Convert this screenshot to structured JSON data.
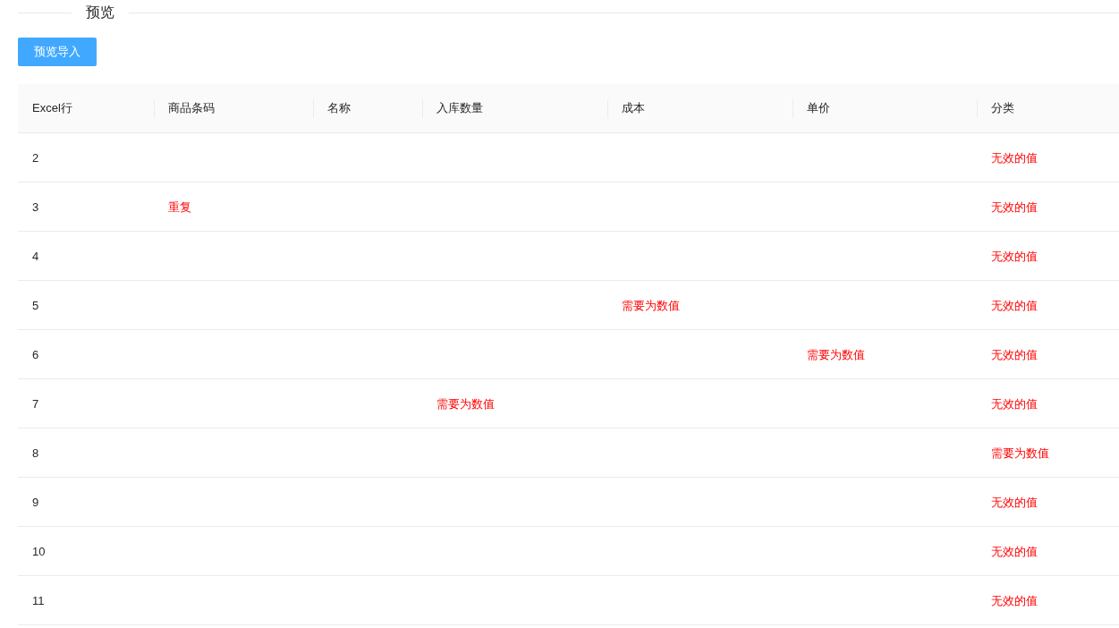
{
  "section": {
    "title": "预览"
  },
  "import_button": {
    "label": "预览导入"
  },
  "table": {
    "columns": [
      "Excel行",
      "商品条码",
      "名称",
      "入库数量",
      "成本",
      "单价",
      "分类"
    ],
    "rows": [
      {
        "excel_row": "2",
        "category": "无效的值"
      },
      {
        "excel_row": "3",
        "barcode": "重复",
        "category": "无效的值"
      },
      {
        "excel_row": "4",
        "category": "无效的值"
      },
      {
        "excel_row": "5",
        "cost": "需要为数值",
        "category": "无效的值"
      },
      {
        "excel_row": "6",
        "unit_price": "需要为数值",
        "category": "无效的值"
      },
      {
        "excel_row": "7",
        "quantity": "需要为数值",
        "category": "无效的值"
      },
      {
        "excel_row": "8",
        "category": "需要为数值"
      },
      {
        "excel_row": "9",
        "category": "无效的值"
      },
      {
        "excel_row": "10",
        "category": "无效的值"
      },
      {
        "excel_row": "11",
        "category": "无效的值"
      }
    ]
  }
}
